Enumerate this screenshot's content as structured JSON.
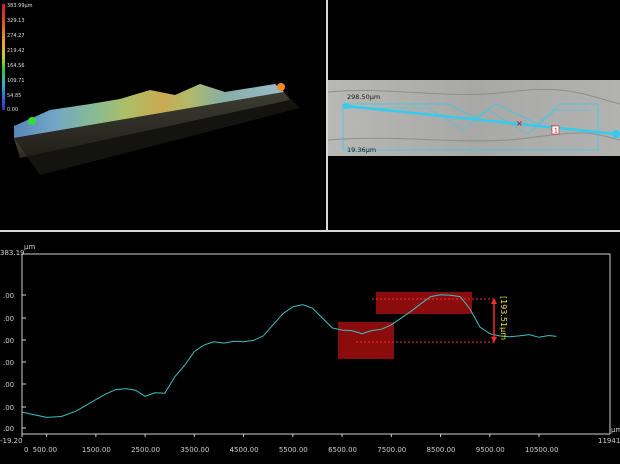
{
  "view3d": {
    "color_scale": {
      "labels": [
        "383.99μm",
        "329.13",
        "274.27",
        "219.42",
        "164.56",
        "109.71",
        "54.85",
        "0.00"
      ],
      "colors": [
        "#d01818",
        "#e35a1e",
        "#e9a22a",
        "#c9cf33",
        "#35c23d",
        "#33b6c9",
        "#2f62d6",
        "#3a2fb8"
      ]
    },
    "start_marker_color": "#33dd33",
    "end_marker_color": "#f08a22"
  },
  "view2d": {
    "line_color": "#33ccee",
    "label_top": "298.50μm",
    "label_bottom": "19.36μm",
    "cursor_label": "1"
  },
  "profile": {
    "unit_x": "μm",
    "unit_y": "μm",
    "y_top_label": "383.19",
    "y_bottom_label": "-19.20",
    "x_end_label": "11941.2",
    "x_tick_labels": [
      "0",
      "500.00",
      "1500.00",
      "2500.00",
      "3500.00",
      "4500.00",
      "5500.00",
      "6500.00",
      "7500.00",
      "8500.00",
      "9500.00",
      "10500.00"
    ],
    "y_tick_labels": [
      ".00",
      ".00",
      ".00",
      ".00",
      ".00",
      ".00",
      ".00"
    ],
    "measurement_label": "[193.51μm",
    "line_color": "#3fc0c0",
    "marker_color": "#9a0d0d"
  },
  "chart_data": {
    "type": "line",
    "xlabel": "μm",
    "ylabel": "μm",
    "xlim": [
      0,
      11941.2
    ],
    "ylim": [
      -19.2,
      383.19
    ],
    "measurement": {
      "value": 193.51,
      "unit": "μm"
    },
    "series": [
      {
        "x": [
          0,
          200,
          500,
          800,
          1100,
          1300,
          1500,
          1700,
          1900,
          2100,
          2300,
          2500,
          2700,
          2900,
          3100,
          3300,
          3500,
          3700,
          3900,
          4100,
          4300,
          4500,
          4700,
          4900,
          5100,
          5300,
          5500,
          5700,
          5900,
          6100,
          6300,
          6500,
          6700,
          6900,
          7100,
          7300,
          7500,
          7700,
          7900,
          8100,
          8300,
          8500,
          8700,
          8900,
          9100,
          9300,
          9500,
          9700,
          9900,
          10100,
          10300,
          10500,
          10700,
          10850
        ],
        "y": [
          30,
          25,
          18,
          20,
          32,
          45,
          58,
          70,
          80,
          82,
          79,
          65,
          73,
          72,
          108,
          134,
          165,
          180,
          187,
          184,
          188,
          187,
          190,
          200,
          225,
          250,
          265,
          270,
          262,
          240,
          218,
          213,
          212,
          205,
          212,
          215,
          225,
          240,
          255,
          272,
          288,
          292,
          291,
          288,
          260,
          220,
          205,
          200,
          198,
          200,
          203,
          197,
          201,
          199
        ]
      }
    ]
  }
}
